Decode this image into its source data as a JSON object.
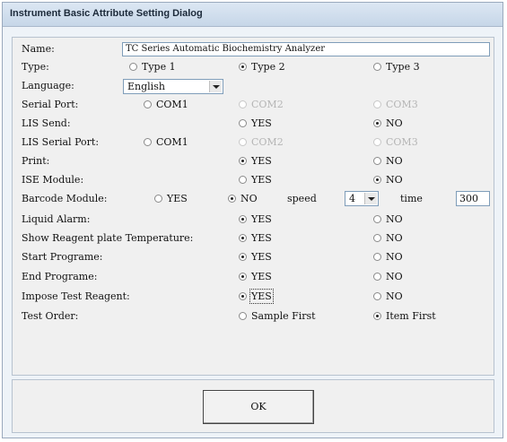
{
  "title": "Instrument Basic Attribute Setting Dialog",
  "name": {
    "label": "Name:",
    "value": "TC Series Automatic Biochemistry Analyzer"
  },
  "type": {
    "label": "Type:",
    "options": [
      "Type 1",
      "Type 2",
      "Type 3"
    ],
    "selected": "Type 2"
  },
  "language": {
    "label": "Language:",
    "value": "English"
  },
  "serial_port": {
    "label": "Serial Port:",
    "options": [
      "COM1",
      "COM2",
      "COM3"
    ]
  },
  "lis_send": {
    "label": "LIS Send:",
    "options": [
      "YES",
      "NO"
    ],
    "selected": "NO"
  },
  "lis_serial_port": {
    "label": "LIS Serial Port:",
    "options": [
      "COM1",
      "COM2",
      "COM3"
    ]
  },
  "print": {
    "label": "Print:",
    "options": [
      "YES",
      "NO"
    ],
    "selected": "YES"
  },
  "ise_module": {
    "label": "ISE Module:",
    "options": [
      "YES",
      "NO"
    ],
    "selected": "NO"
  },
  "barcode_module": {
    "label": "Barcode Module:",
    "options": [
      "YES",
      "NO"
    ],
    "selected": "NO",
    "speed_label": "speed",
    "speed_value": "4",
    "time_label": "time",
    "time_value": "300"
  },
  "liquid_alarm": {
    "label": "Liquid Alarm:",
    "options": [
      "YES",
      "NO"
    ],
    "selected": "YES"
  },
  "show_reagent_temp": {
    "label": "Show Reagent plate Temperature:",
    "options": [
      "YES",
      "NO"
    ],
    "selected": "YES"
  },
  "start_programe": {
    "label": "Start Programe:",
    "options": [
      "YES",
      "NO"
    ],
    "selected": "YES"
  },
  "end_programe": {
    "label": "End Programe:",
    "options": [
      "YES",
      "NO"
    ],
    "selected": "YES"
  },
  "impose_test_reagent": {
    "label": "Impose Test Reagent:",
    "options": [
      "YES",
      "NO"
    ],
    "selected": "YES"
  },
  "test_order": {
    "label": "Test Order:",
    "options": [
      "Sample First",
      "Item First"
    ],
    "selected": "Item First"
  },
  "ok_label": "OK"
}
